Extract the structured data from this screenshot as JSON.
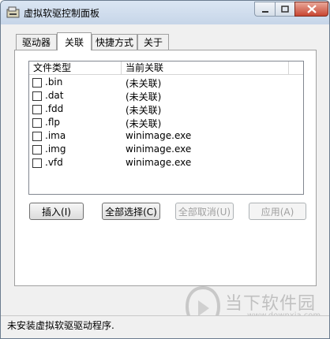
{
  "window": {
    "title": "虚拟软驱控制面板"
  },
  "tabs": [
    {
      "label": "驱动器",
      "active": false
    },
    {
      "label": "关联",
      "active": true
    },
    {
      "label": "快捷方式",
      "active": false
    },
    {
      "label": "关于",
      "active": false
    }
  ],
  "list": {
    "columns": [
      "文件类型",
      "当前关联"
    ],
    "rows": [
      {
        "ext": ".bin",
        "assoc": "(未关联)",
        "checked": false
      },
      {
        "ext": ".dat",
        "assoc": "(未关联)",
        "checked": false
      },
      {
        "ext": ".fdd",
        "assoc": "(未关联)",
        "checked": false
      },
      {
        "ext": ".flp",
        "assoc": "(未关联)",
        "checked": false
      },
      {
        "ext": ".ima",
        "assoc": "winimage.exe",
        "checked": false
      },
      {
        "ext": ".img",
        "assoc": "winimage.exe",
        "checked": false
      },
      {
        "ext": ".vfd",
        "assoc": "winimage.exe",
        "checked": false
      }
    ]
  },
  "buttons": {
    "insert": "插入(I)",
    "select_all": "全部选择(C)",
    "cancel_all": "全部取消(U)",
    "apply": "应用(A)"
  },
  "status": {
    "text": "未安装虚拟软驱驱动程序."
  },
  "watermark": {
    "brand": "当下软件园",
    "site": "www.downxia.com"
  },
  "icons": {
    "app": "floppy-drive-icon",
    "minimize": "minimize-icon",
    "maximize": "maximize-icon",
    "close": "close-icon"
  },
  "colors": {
    "close_button": "#c84632",
    "titlebar": "#c6d5e8"
  }
}
